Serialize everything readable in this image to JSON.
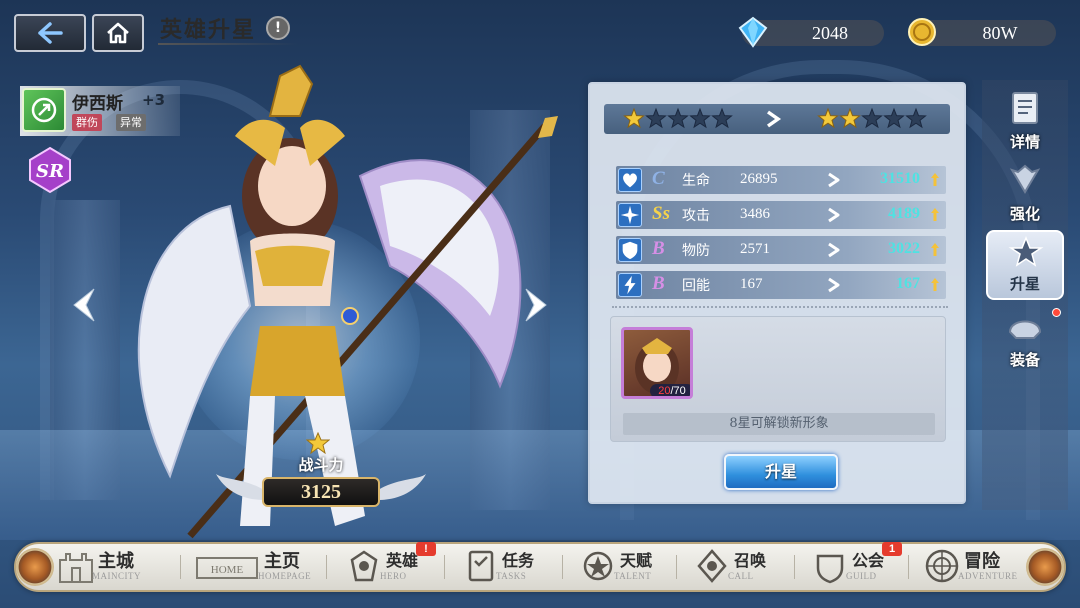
{
  "header": {
    "title": "英雄升星",
    "info_label": "!",
    "currency": [
      {
        "icon": "diamond-icon",
        "value": "2048"
      },
      {
        "icon": "gold-coin-icon",
        "value": "80W"
      }
    ]
  },
  "hero": {
    "name": "伊西斯",
    "level_bonus": "+3",
    "tags": [
      "群伤",
      "异常"
    ],
    "rarity": "SR",
    "combat_power_label": "战斗力",
    "combat_power": "3125",
    "star_count": 1
  },
  "star_upgrade": {
    "current_stars": 1,
    "next_stars": 2,
    "max_stars": 5,
    "stats": [
      {
        "grade": "C",
        "grade_color": "#8fb2e6",
        "name": "生命",
        "current": "26895",
        "next": "31510",
        "icon": "heart-shield-icon"
      },
      {
        "grade": "Ss",
        "grade_color": "#f6d34a",
        "name": "攻击",
        "current": "3486",
        "next": "4189",
        "icon": "shuriken-icon"
      },
      {
        "grade": "B",
        "grade_color": "#d68fe6",
        "name": "物防",
        "current": "2571",
        "next": "3022",
        "icon": "shield-icon"
      },
      {
        "grade": "B",
        "grade_color": "#d68fe6",
        "name": "回能",
        "current": "167",
        "next": "167",
        "icon": "energy-icon"
      }
    ],
    "shards": {
      "owned": "20",
      "required": "/70",
      "owned_color": "#ff4040"
    },
    "unlock_hint": "8星可解锁新形象",
    "upgrade_button": "升星"
  },
  "sidebar": {
    "items": [
      {
        "label": "详情",
        "icon": "document-icon",
        "active": false
      },
      {
        "label": "强化",
        "icon": "wings-icon",
        "active": false
      },
      {
        "label": "升星",
        "icon": "star-wings-icon",
        "active": true
      },
      {
        "label": "装备",
        "icon": "helmet-icon",
        "active": false,
        "has_dot": true
      }
    ]
  },
  "bottom_nav": [
    {
      "cn": "主城",
      "en": "MAINCITY",
      "icon": "castle-icon"
    },
    {
      "cn": "主页",
      "en": "HOMEPAGE",
      "icon": "home-sign-icon",
      "sign_text": "HOME"
    },
    {
      "cn": "英雄",
      "en": "HERO",
      "icon": "hero-icon",
      "badge": "!"
    },
    {
      "cn": "任务",
      "en": "TASKS",
      "icon": "task-icon"
    },
    {
      "cn": "天赋",
      "en": "TALENT",
      "icon": "talent-icon"
    },
    {
      "cn": "召唤",
      "en": "CALL",
      "icon": "summon-icon"
    },
    {
      "cn": "公会",
      "en": "GUILD",
      "icon": "guild-icon",
      "badge": "1"
    },
    {
      "cn": "冒险",
      "en": "ADVENTURE",
      "icon": "adventure-icon"
    }
  ],
  "colors": {
    "panel_bg": "#e1e8f2",
    "stat_new": "#4fe2e2",
    "star_gold": "#f3c93a",
    "star_empty": "#2c3e58",
    "button_blue": "#2f8fdd"
  }
}
